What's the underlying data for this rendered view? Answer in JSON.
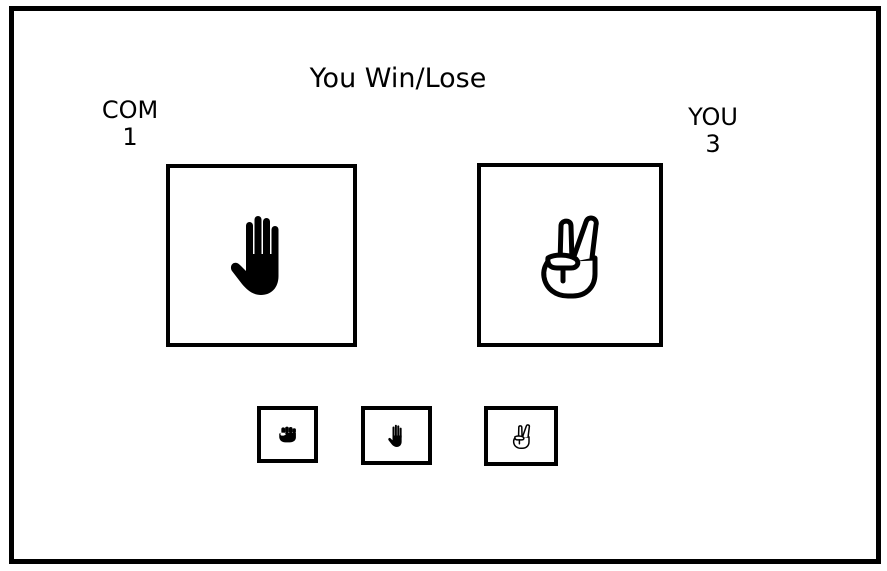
{
  "result": {
    "text": "You Win/Lose"
  },
  "com": {
    "label": "COM",
    "score": "1",
    "hand": "paper-hand-icon"
  },
  "you": {
    "label": "YOU",
    "score": "3",
    "hand": "scissors-hand-icon"
  },
  "choices": [
    {
      "name": "rock",
      "icon": "rock-fist-icon"
    },
    {
      "name": "paper",
      "icon": "paper-hand-icon"
    },
    {
      "name": "scissors",
      "icon": "scissors-hand-icon"
    }
  ]
}
